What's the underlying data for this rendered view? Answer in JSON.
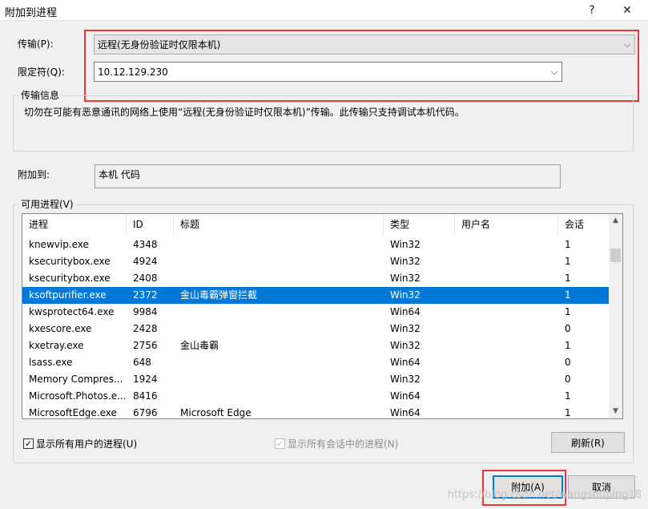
{
  "window": {
    "title": "附加到进程",
    "help_icon": "?",
    "close_icon": "✕"
  },
  "transport": {
    "label": "传输(P):",
    "value": "远程(无身份验证时仅限本机)"
  },
  "qualifier": {
    "label": "限定符(Q):",
    "value": "10.12.129.230"
  },
  "transport_info": {
    "title": "传输信息",
    "text": "切勿在可能有恶意通讯的网络上使用“远程(无身份验证时仅限本机)”传输。此传输只支持调试本机代码。"
  },
  "attach_to": {
    "label": "附加到:",
    "value": "本机 代码"
  },
  "processes": {
    "title": "可用进程(V)",
    "columns": [
      "进程",
      "ID",
      "标题",
      "类型",
      "用户名",
      "会话"
    ],
    "rows": [
      {
        "name": "knewvip.exe",
        "id": "4348",
        "title": "",
        "type": "Win32",
        "user": "",
        "session": "1"
      },
      {
        "name": "ksecuritybox.exe",
        "id": "4924",
        "title": "",
        "type": "Win32",
        "user": "",
        "session": "1"
      },
      {
        "name": "ksecuritybox.exe",
        "id": "2408",
        "title": "",
        "type": "Win32",
        "user": "",
        "session": "1"
      },
      {
        "name": "ksoftpurifier.exe",
        "id": "2372",
        "title": "金山毒霸弹窗拦截",
        "type": "Win32",
        "user": "",
        "session": "1",
        "selected": true
      },
      {
        "name": "kwsprotect64.exe",
        "id": "9984",
        "title": "",
        "type": "Win64",
        "user": "",
        "session": "1"
      },
      {
        "name": "kxescore.exe",
        "id": "2428",
        "title": "",
        "type": "Win32",
        "user": "",
        "session": "0"
      },
      {
        "name": "kxetray.exe",
        "id": "2756",
        "title": "金山毒霸",
        "type": "Win32",
        "user": "",
        "session": "1"
      },
      {
        "name": "lsass.exe",
        "id": "648",
        "title": "",
        "type": "Win64",
        "user": "",
        "session": "0"
      },
      {
        "name": "Memory Compres...",
        "id": "1924",
        "title": "",
        "type": "Win32",
        "user": "",
        "session": "0"
      },
      {
        "name": "Microsoft.Photos.e...",
        "id": "8416",
        "title": "",
        "type": "Win64",
        "user": "",
        "session": "1"
      },
      {
        "name": "MicrosoftEdge.exe",
        "id": "6796",
        "title": "Microsoft Edge",
        "type": "Win64",
        "user": "",
        "session": "1"
      }
    ]
  },
  "options": {
    "show_all_users": "显示所有用户的进程(U)",
    "show_all_sessions": "显示所有会话中的进程(N)"
  },
  "buttons": {
    "refresh": "刷新(R)",
    "attach": "附加(A)",
    "cancel": "取消"
  },
  "watermark": "https://blog.csdn.net/wangshuping18",
  "colors": {
    "highlight": "#e8383d",
    "selection": "#0078d7"
  }
}
